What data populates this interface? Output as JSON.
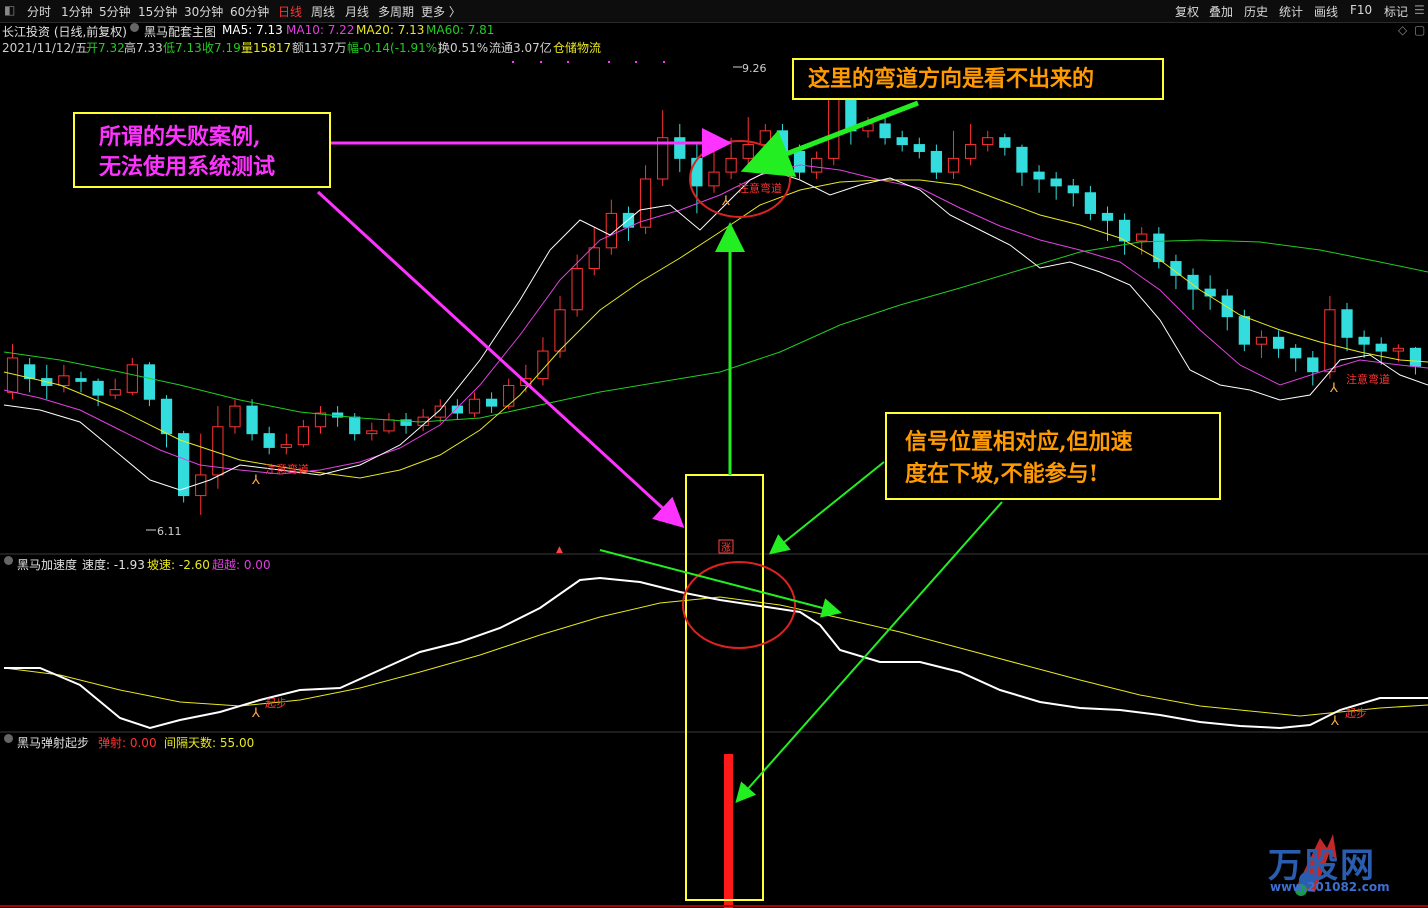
{
  "toolbar": {
    "periods": [
      "分时",
      "1分钟",
      "5分钟",
      "15分钟",
      "30分钟",
      "60分钟",
      "日线",
      "周线",
      "月线",
      "多周期",
      "更多 〉"
    ],
    "active_period": "日线",
    "tools": [
      "复权",
      "叠加",
      "历史",
      "统计",
      "画线",
      "F10",
      "标记"
    ]
  },
  "header": {
    "stock": "长江投资 (日线,前复权)",
    "indicator": "黑马配套主图",
    "ma5": "MA5: 7.13",
    "ma10": "MA10: 7.22",
    "ma20": "MA20: 7.13",
    "ma60": "MA60: 7.81"
  },
  "quote": {
    "date": "2021/11/12/五",
    "open": "开7.32",
    "high": "高7.33",
    "low": "低7.13",
    "close": "收7.19",
    "volume": "量15817",
    "amount": "额1137万",
    "change": "幅-0.14(-1.91%)",
    "turnover": "换0.51%",
    "float": "流通3.07亿",
    "sector": "仓储物流"
  },
  "chart_labels": {
    "high_price": "9.26",
    "low_price": "6.11",
    "signal_1": "注意弯道",
    "signal_2": "注意弯道",
    "signal_3": "注意弯道",
    "mark_1": "起步",
    "mark_2": "起步",
    "mark_3": "涨"
  },
  "panel2": {
    "title": "黑马加速度",
    "speed": "速度: -1.93",
    "slope": "坡速: -2.60",
    "exceed": "超越: 0.00"
  },
  "panel3": {
    "title": "黑马弹射起步",
    "launch": "弹射: 0.00",
    "interval": "间隔天数: 55.00"
  },
  "annotations": {
    "note1_line1": "所谓的失败案例,",
    "note1_line2": "无法使用系统测试",
    "note2": "这里的弯道方向是看不出来的",
    "note3_line1": "信号位置相对应,但加速",
    "note3_line2": "度在下坡,不能参与!"
  },
  "watermark": {
    "brand": "万股网",
    "url": "www.201082.com"
  },
  "colors": {
    "up": "#ff3333",
    "down": "#33dddd",
    "ma5": "#ffffff",
    "ma10": "#e040e0",
    "ma20": "#e8e820",
    "ma60": "#22cc22",
    "annotation_border": "#ffff33",
    "arrow_green": "#22ee22",
    "arrow_magenta": "#ff33ff"
  },
  "chart_data": {
    "type": "candlestick",
    "ylim": [
      6.0,
      9.4
    ],
    "candles": [
      [
        7.0,
        7.25,
        7.35,
        6.95
      ],
      [
        7.2,
        7.1,
        7.25,
        7.0
      ],
      [
        7.1,
        7.05,
        7.2,
        6.95
      ],
      [
        7.05,
        7.12,
        7.2,
        7.0
      ],
      [
        7.1,
        7.08,
        7.15,
        7.0
      ],
      [
        7.08,
        6.98,
        7.1,
        6.9
      ],
      [
        6.98,
        7.02,
        7.1,
        6.95
      ],
      [
        7.0,
        7.2,
        7.25,
        6.98
      ],
      [
        7.2,
        6.95,
        7.22,
        6.9
      ],
      [
        6.95,
        6.7,
        6.98,
        6.6
      ],
      [
        6.7,
        6.25,
        6.72,
        6.2
      ],
      [
        6.25,
        6.4,
        6.7,
        6.11
      ],
      [
        6.4,
        6.75,
        6.9,
        6.3
      ],
      [
        6.75,
        6.9,
        6.95,
        6.7
      ],
      [
        6.9,
        6.7,
        6.95,
        6.65
      ],
      [
        6.7,
        6.6,
        6.75,
        6.55
      ],
      [
        6.6,
        6.62,
        6.7,
        6.55
      ],
      [
        6.62,
        6.75,
        6.8,
        6.6
      ],
      [
        6.75,
        6.85,
        6.9,
        6.7
      ],
      [
        6.85,
        6.82,
        6.9,
        6.75
      ],
      [
        6.82,
        6.7,
        6.85,
        6.65
      ],
      [
        6.7,
        6.72,
        6.78,
        6.65
      ],
      [
        6.72,
        6.8,
        6.85,
        6.7
      ],
      [
        6.8,
        6.76,
        6.85,
        6.7
      ],
      [
        6.76,
        6.82,
        6.88,
        6.72
      ],
      [
        6.82,
        6.9,
        6.95,
        6.78
      ],
      [
        6.9,
        6.85,
        6.95,
        6.8
      ],
      [
        6.85,
        6.95,
        7.0,
        6.82
      ],
      [
        6.95,
        6.9,
        7.0,
        6.85
      ],
      [
        6.9,
        7.05,
        7.1,
        6.88
      ],
      [
        7.05,
        7.1,
        7.2,
        7.0
      ],
      [
        7.1,
        7.3,
        7.4,
        7.05
      ],
      [
        7.3,
        7.6,
        7.7,
        7.25
      ],
      [
        7.6,
        7.9,
        8.0,
        7.55
      ],
      [
        7.9,
        8.05,
        8.2,
        7.85
      ],
      [
        8.05,
        8.3,
        8.4,
        8.0
      ],
      [
        8.3,
        8.2,
        8.35,
        8.1
      ],
      [
        8.2,
        8.55,
        8.65,
        8.15
      ],
      [
        8.55,
        8.85,
        9.05,
        8.5
      ],
      [
        8.85,
        8.7,
        8.95,
        8.6
      ],
      [
        8.7,
        8.5,
        8.8,
        8.3
      ],
      [
        8.5,
        8.6,
        8.75,
        8.45
      ],
      [
        8.6,
        8.7,
        8.85,
        8.55
      ],
      [
        8.7,
        8.8,
        9.0,
        8.65
      ],
      [
        8.8,
        8.9,
        8.95,
        8.75
      ],
      [
        8.9,
        8.75,
        8.95,
        8.7
      ],
      [
        8.75,
        8.6,
        8.8,
        8.55
      ],
      [
        8.6,
        8.7,
        8.75,
        8.55
      ],
      [
        8.7,
        9.26,
        9.26,
        8.65
      ],
      [
        9.26,
        8.9,
        9.26,
        8.8
      ],
      [
        8.9,
        8.95,
        9.0,
        8.85
      ],
      [
        8.95,
        8.85,
        9.0,
        8.8
      ],
      [
        8.85,
        8.8,
        8.9,
        8.75
      ],
      [
        8.8,
        8.75,
        8.85,
        8.7
      ],
      [
        8.75,
        8.6,
        8.8,
        8.55
      ],
      [
        8.6,
        8.7,
        8.9,
        8.55
      ],
      [
        8.7,
        8.8,
        8.95,
        8.65
      ],
      [
        8.8,
        8.85,
        8.9,
        8.75
      ],
      [
        8.85,
        8.78,
        8.88,
        8.72
      ],
      [
        8.78,
        8.6,
        8.8,
        8.5
      ],
      [
        8.6,
        8.55,
        8.65,
        8.45
      ],
      [
        8.55,
        8.5,
        8.6,
        8.4
      ],
      [
        8.5,
        8.45,
        8.55,
        8.35
      ],
      [
        8.45,
        8.3,
        8.5,
        8.25
      ],
      [
        8.3,
        8.25,
        8.35,
        8.1
      ],
      [
        8.25,
        8.1,
        8.3,
        8.0
      ],
      [
        8.1,
        8.15,
        8.2,
        8.0
      ],
      [
        8.15,
        7.95,
        8.2,
        7.9
      ],
      [
        7.95,
        7.85,
        8.0,
        7.75
      ],
      [
        7.85,
        7.75,
        7.9,
        7.6
      ],
      [
        7.75,
        7.7,
        7.85,
        7.6
      ],
      [
        7.7,
        7.55,
        7.75,
        7.45
      ],
      [
        7.55,
        7.35,
        7.6,
        7.3
      ],
      [
        7.35,
        7.4,
        7.45,
        7.25
      ],
      [
        7.4,
        7.32,
        7.45,
        7.25
      ],
      [
        7.32,
        7.25,
        7.35,
        7.15
      ],
      [
        7.25,
        7.15,
        7.3,
        7.05
      ],
      [
        7.15,
        7.6,
        7.7,
        7.1
      ],
      [
        7.6,
        7.4,
        7.65,
        7.3
      ],
      [
        7.4,
        7.35,
        7.45,
        7.25
      ],
      [
        7.35,
        7.3,
        7.4,
        7.2
      ],
      [
        7.3,
        7.32,
        7.35,
        7.22
      ],
      [
        7.32,
        7.19,
        7.33,
        7.13
      ]
    ]
  }
}
